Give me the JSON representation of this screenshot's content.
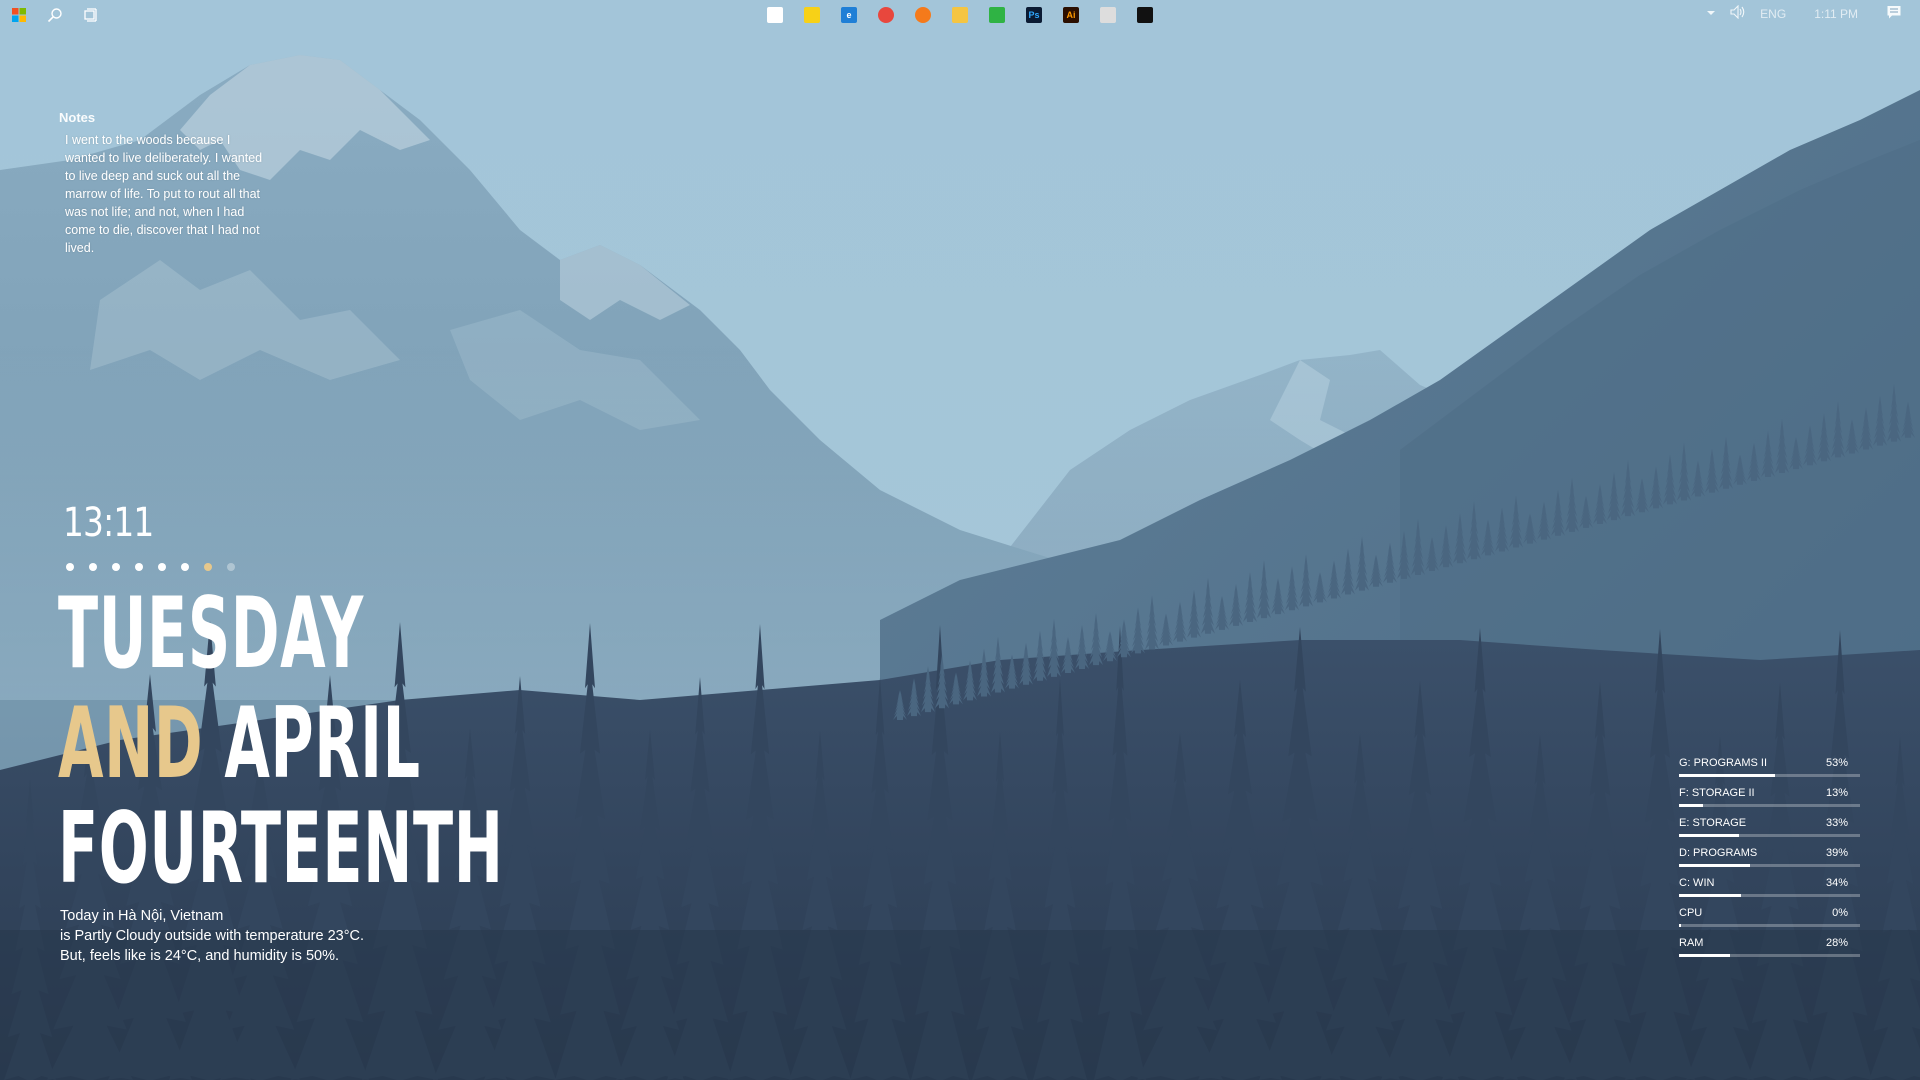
{
  "taskbar": {
    "left_icons": [
      {
        "name": "windows-start-icon"
      },
      {
        "name": "search-icon"
      },
      {
        "name": "task-view-icon"
      }
    ],
    "apps": [
      {
        "name": "app-grid-icon",
        "label": "",
        "bg": "#ffffff",
        "fg": "#d04040"
      },
      {
        "name": "sticky-notes-icon",
        "label": "",
        "bg": "#f7d117",
        "fg": "#333333"
      },
      {
        "name": "edge-icon",
        "label": "e",
        "bg": "#1f7fd6",
        "fg": "#ffffff"
      },
      {
        "name": "chrome-icon",
        "label": "",
        "bg": "#e8473d",
        "fg": "#ffffff"
      },
      {
        "name": "firefox-icon",
        "label": "",
        "bg": "#f57a1b",
        "fg": "#ffffff"
      },
      {
        "name": "file-explorer-icon",
        "label": "",
        "bg": "#f4c542",
        "fg": "#333333"
      },
      {
        "name": "evernote-icon",
        "label": "",
        "bg": "#2fb344",
        "fg": "#ffffff"
      },
      {
        "name": "photoshop-icon",
        "label": "Ps",
        "bg": "#0b1b33",
        "fg": "#31a8ff"
      },
      {
        "name": "illustrator-icon",
        "label": "Ai",
        "bg": "#2c0f00",
        "fg": "#ff9a00"
      },
      {
        "name": "media-player-icon",
        "label": "",
        "bg": "#dddddd",
        "fg": "#333333"
      },
      {
        "name": "steam-icon",
        "label": "",
        "bg": "#111111",
        "fg": "#ffffff"
      }
    ],
    "tray": {
      "language": "ENG",
      "time": "1:11 PM"
    }
  },
  "notes": {
    "title": "Notes",
    "body": "I went to the woods because I wanted to live deliberately. I wanted to live deep and suck out all the marrow of life. To put to rout all that was not life; and not, when I had come to die, discover that I had not lived."
  },
  "clock": {
    "time": "13:11",
    "dots": [
      {
        "state": "on"
      },
      {
        "state": "on"
      },
      {
        "state": "on"
      },
      {
        "state": "on"
      },
      {
        "state": "on"
      },
      {
        "state": "on"
      },
      {
        "state": "active"
      },
      {
        "state": "dim"
      }
    ]
  },
  "date": {
    "day": "TUESDAY",
    "connector": "AND",
    "month": "APRIL",
    "day_of_month": "FOURTEENTH",
    "accent_color": "#e7c88c"
  },
  "weather": {
    "line1": "Today in Hà Nội, Vietnam",
    "line2": "is Partly Cloudy outside with temperature 23°C.",
    "line3": "But, feels like is 24°C, and humidity is 50%."
  },
  "meters": [
    {
      "label": "G: PROGRAMS II",
      "percent_text": "53%",
      "value": 53
    },
    {
      "label": "F: STORAGE II",
      "percent_text": "13%",
      "value": 13
    },
    {
      "label": "E: STORAGE",
      "percent_text": "33%",
      "value": 33
    },
    {
      "label": "D: PROGRAMS",
      "percent_text": "39%",
      "value": 39
    },
    {
      "label": "C: WIN",
      "percent_text": "34%",
      "value": 34
    },
    {
      "label": "CPU",
      "percent_text": "0%",
      "value": 0
    },
    {
      "label": "RAM",
      "percent_text": "28%",
      "value": 28
    }
  ],
  "colors": {
    "sky_top": "#a7c8db",
    "sky_bottom": "#9cbfd3",
    "mountain": "#7c9fb6",
    "forest_dark": "#2f3f55",
    "accent": "#e7c88c"
  }
}
